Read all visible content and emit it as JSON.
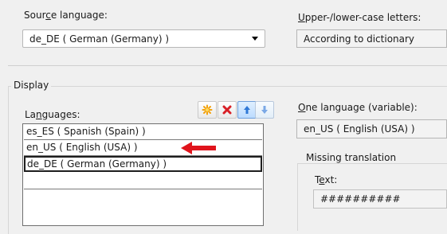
{
  "source_language": {
    "label_prefix": "Sour",
    "label_mnemonic": "c",
    "label_suffix": "e language:",
    "value": "de_DE ( German (Germany) )"
  },
  "case_letters": {
    "label_mnemonic": "U",
    "label_suffix": "pper-/lower-case letters:",
    "value": "According to dictionary"
  },
  "display": {
    "group_label": "Display",
    "languages_label_prefix": "La",
    "languages_label_mnemonic": "n",
    "languages_label_suffix": "guages:",
    "toolbar": {
      "add_icon": "star-add-icon",
      "delete_icon": "red-x-delete-icon",
      "up_icon": "blue-up-arrow-icon",
      "down_icon": "blue-down-arrow-icon"
    },
    "languages": [
      "es_ES ( Spanish (Spain) )",
      "en_US ( English (USA) )",
      "de_DE ( German (Germany) )",
      "",
      ""
    ],
    "one_language": {
      "label_mnemonic": "O",
      "label_suffix": "ne language (variable):",
      "value": "en_US ( English (USA) )"
    },
    "missing_translation": {
      "group_label": "Missing translation",
      "text_label_prefix": "T",
      "text_label_mnemonic": "e",
      "text_label_suffix": "xt:",
      "text_value": "##########"
    }
  },
  "colors": {
    "background": "#f0f0f0",
    "annotation_arrow": "#e0141c",
    "up_down_arrow": "#2f78d6",
    "delete_x": "#d81f26",
    "add_star": "#f2a20f"
  }
}
